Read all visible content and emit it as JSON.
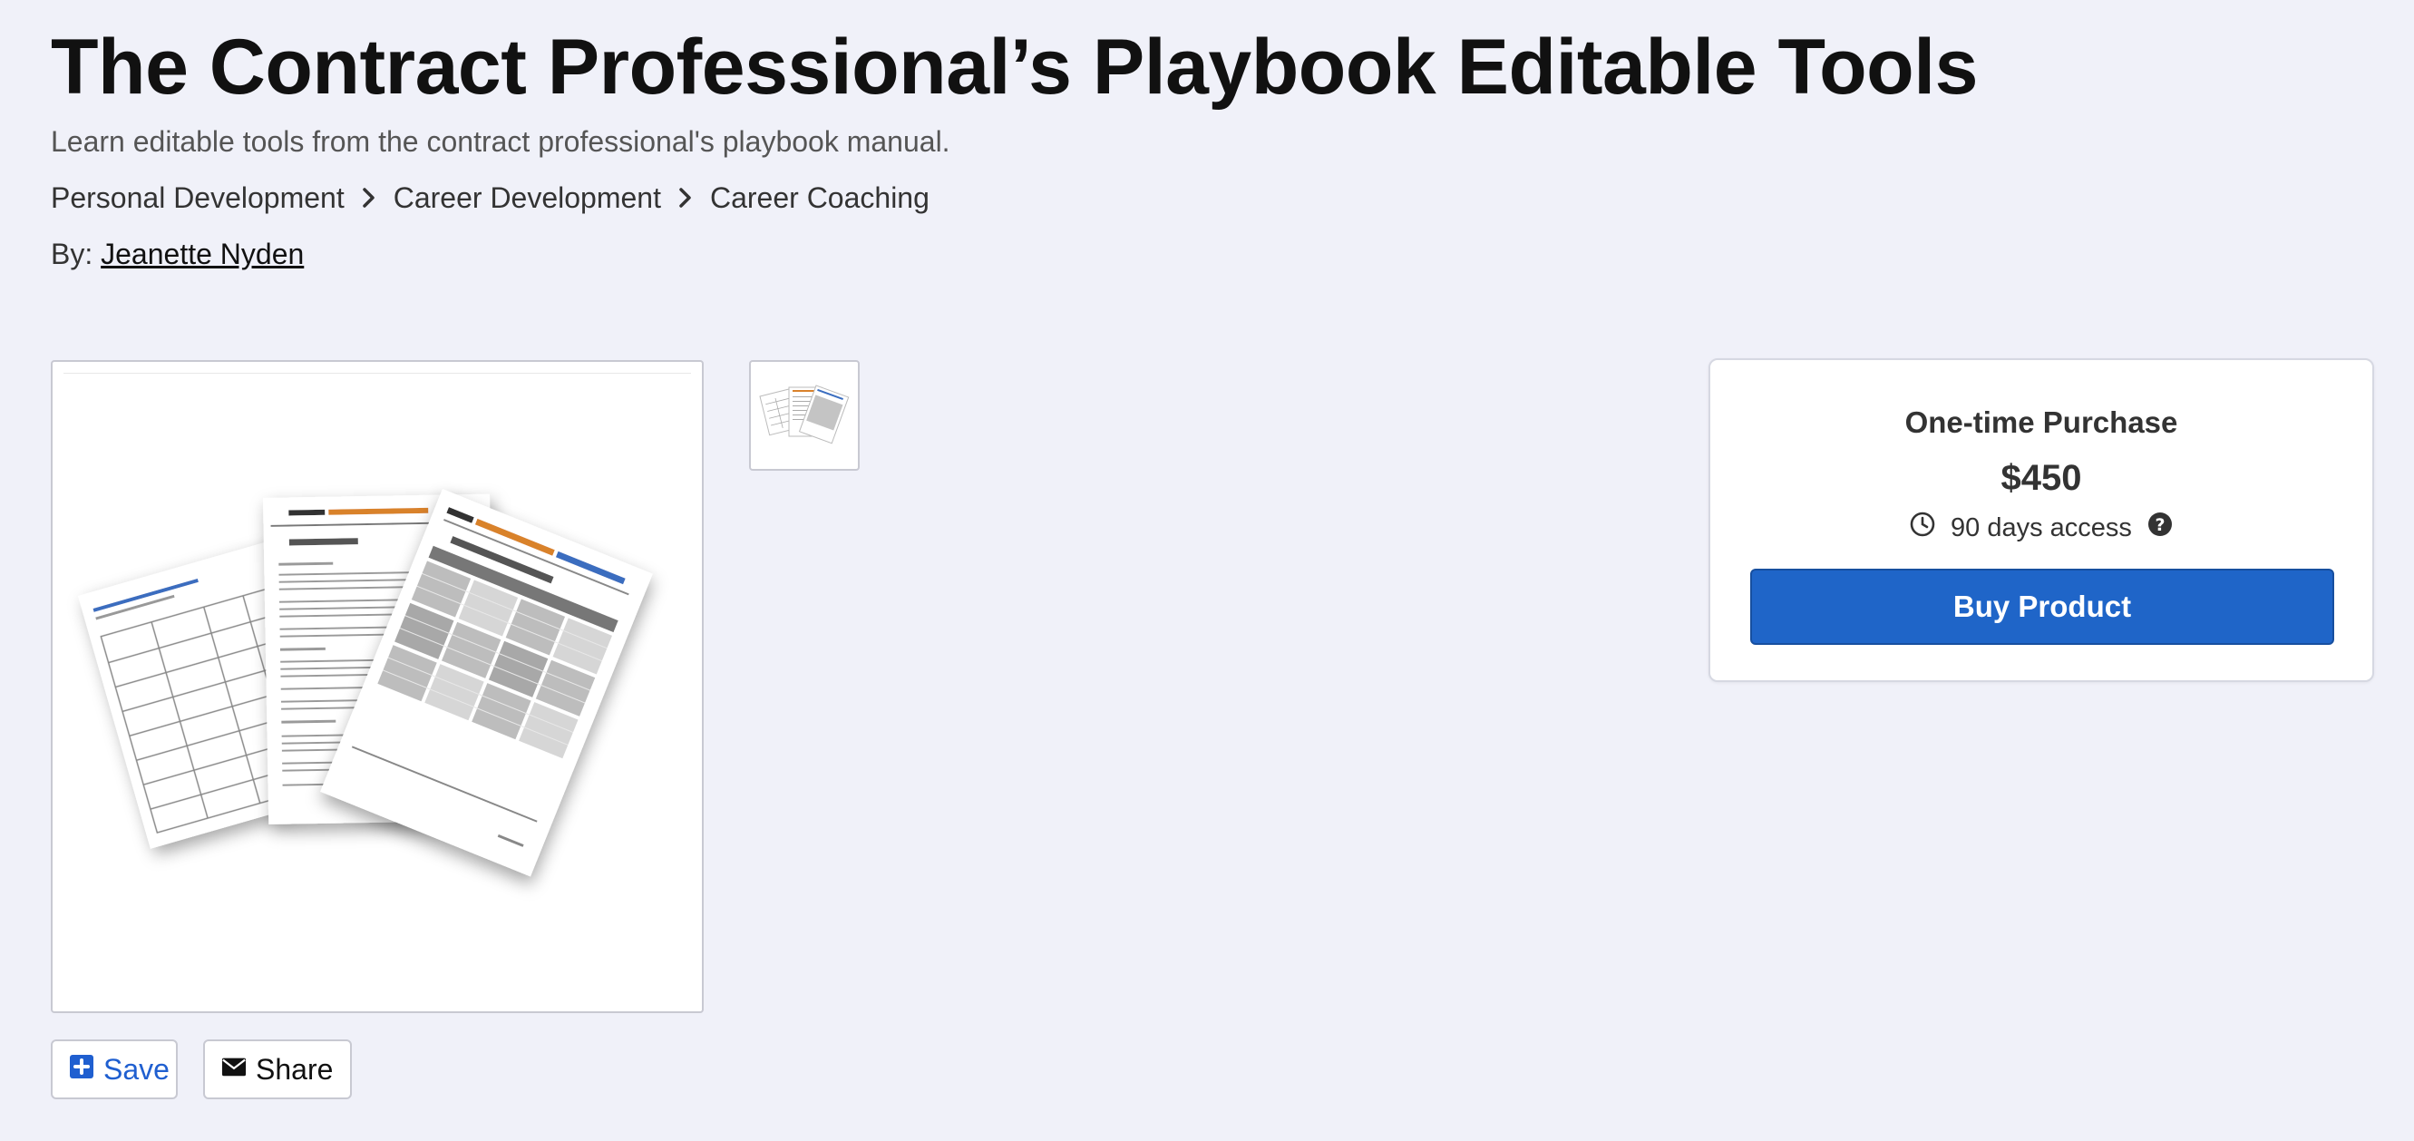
{
  "product": {
    "title": "The Contract Professional’s Playbook Editable Tools",
    "subtitle": "Learn editable tools from the contract professional's playbook manual."
  },
  "breadcrumb": [
    {
      "label": "Personal Development"
    },
    {
      "label": "Career Development"
    },
    {
      "label": "Career Coaching"
    }
  ],
  "author": {
    "prefix": "By:",
    "name": "Jeanette Nyden"
  },
  "purchase": {
    "type_label": "One-time Purchase",
    "price": "$450",
    "access": "90 days access",
    "buy_label": "Buy Product"
  },
  "actions": {
    "save_label": "Save",
    "share_label": "Share"
  },
  "icons": {
    "breadcrumb_separator": "chevron-right-icon",
    "access": "clock-icon",
    "help": "question-circle-icon",
    "save": "plus-square-icon",
    "share": "envelope-icon"
  },
  "colors": {
    "background": "#f0f1f9",
    "primary": "#1f65c8",
    "save_text": "#1f5fd0"
  }
}
